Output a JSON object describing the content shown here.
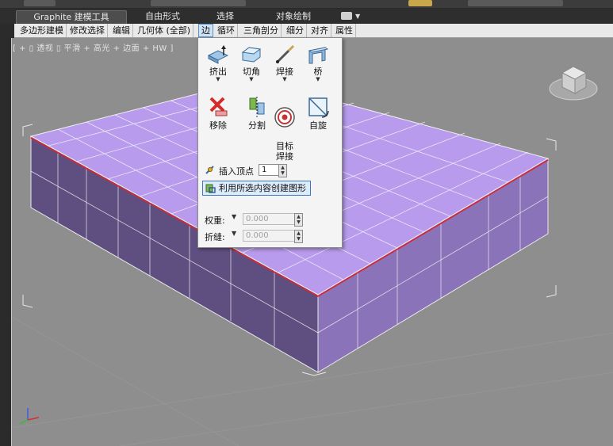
{
  "ribbon": {
    "tabs": [
      {
        "label": "Graphite 建模工具",
        "active": true
      },
      {
        "label": "自由形式",
        "active": false
      },
      {
        "label": "选择",
        "active": false
      },
      {
        "label": "对象绘制",
        "active": false
      }
    ]
  },
  "subtabs": [
    {
      "label": "多边形建模"
    },
    {
      "label": "修改选择"
    },
    {
      "label": "编辑"
    },
    {
      "label": "几何体 (全部)"
    },
    {
      "label": "边",
      "active": true
    },
    {
      "label": "循环"
    },
    {
      "label": "三角剖分"
    },
    {
      "label": "细分"
    },
    {
      "label": "对齐"
    },
    {
      "label": "属性"
    }
  ],
  "viewport": {
    "label": "[ + ▯ 透视 ▯ 平滑 + 高光 + 边面 + HW ]",
    "object_color": "#b494e8"
  },
  "edge_panel": {
    "tools": [
      {
        "name": "extrude",
        "label": "挤出",
        "has_dropdown": true
      },
      {
        "name": "chamfer",
        "label": "切角",
        "has_dropdown": true
      },
      {
        "name": "weld",
        "label": "焊接",
        "has_dropdown": true
      },
      {
        "name": "bridge",
        "label": "桥",
        "has_dropdown": true
      },
      {
        "name": "remove",
        "label": "移除",
        "has_dropdown": false
      },
      {
        "name": "split",
        "label": "分割",
        "has_dropdown": false
      },
      {
        "name": "target-weld",
        "label": "目标\n焊接",
        "has_dropdown": false
      },
      {
        "name": "spin",
        "label": "自旋",
        "has_dropdown": false
      }
    ],
    "insert_vertex": {
      "label": "插入顶点",
      "value": "1"
    },
    "create_shape": {
      "label": "利用所选内容创建图形"
    },
    "crease": {
      "label": "权重:",
      "value": "0.000"
    },
    "fold": {
      "label": "折缝:",
      "value": "0.000"
    }
  }
}
